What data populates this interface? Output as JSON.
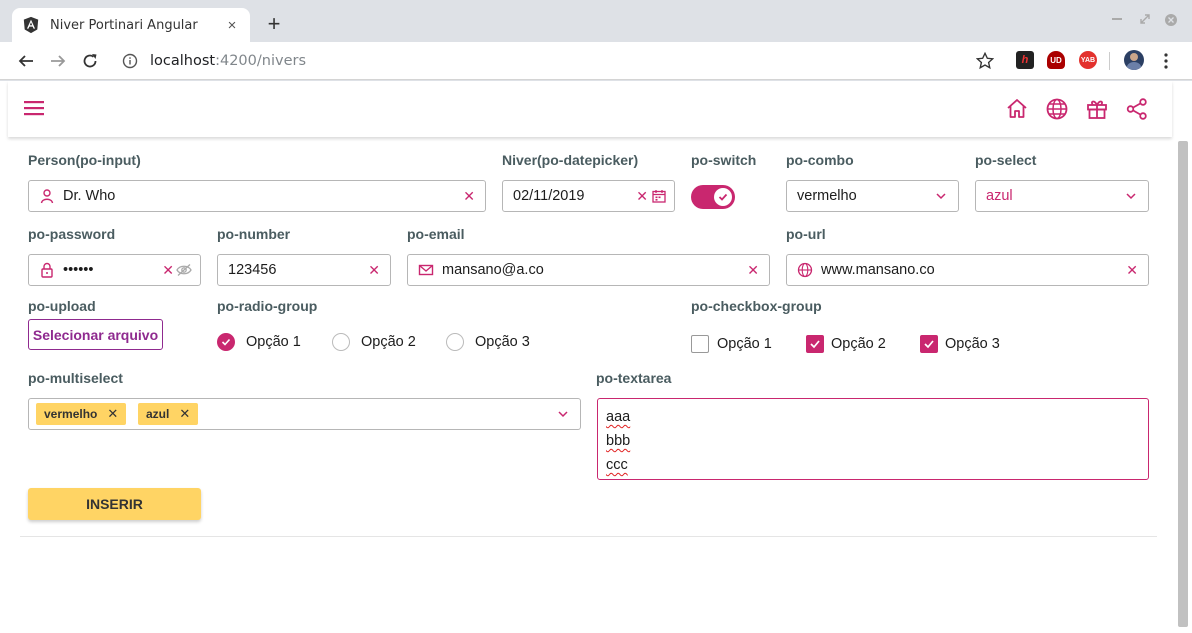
{
  "browser": {
    "tab_title": "Niver Portinari Angular",
    "tab_close": "×",
    "new_tab": "+",
    "url_host": "localhost",
    "url_path": ":4200/nivers",
    "ext_labels": [
      "h",
      "UD",
      "YAB"
    ]
  },
  "form": {
    "person": {
      "label": "Person(po-input)",
      "value": "Dr. Who"
    },
    "niver": {
      "label": "Niver(po-datepicker)",
      "value": "02/11/2019"
    },
    "switch": {
      "label": "po-switch",
      "on": true
    },
    "combo": {
      "label": "po-combo",
      "value": "vermelho"
    },
    "select": {
      "label": "po-select",
      "value": "azul"
    },
    "password": {
      "label": "po-password",
      "value": "••••••"
    },
    "number": {
      "label": "po-number",
      "value": "123456"
    },
    "email": {
      "label": "po-email",
      "value": "mansano@a.co"
    },
    "url": {
      "label": "po-url",
      "value": "www.mansano.co"
    },
    "upload": {
      "label": "po-upload",
      "button": "Selecionar arquivo"
    },
    "radio": {
      "label": "po-radio-group",
      "options": [
        "Opção 1",
        "Opção 2",
        "Opção 3"
      ],
      "selected": 0
    },
    "checkbox": {
      "label": "po-checkbox-group",
      "options": [
        "Opção 1",
        "Opção 2",
        "Opção 3"
      ],
      "checked": [
        false,
        true,
        true
      ]
    },
    "multiselect": {
      "label": "po-multiselect",
      "chips": [
        "vermelho",
        "azul"
      ]
    },
    "textarea": {
      "label": "po-textarea",
      "lines": [
        "aaa",
        "bbb",
        "ccc"
      ]
    },
    "insert_button": "INSERIR"
  },
  "colors": {
    "primary": "#c9276f",
    "accent_yellow": "#ffd464",
    "upload_border": "#8f2a8f"
  }
}
